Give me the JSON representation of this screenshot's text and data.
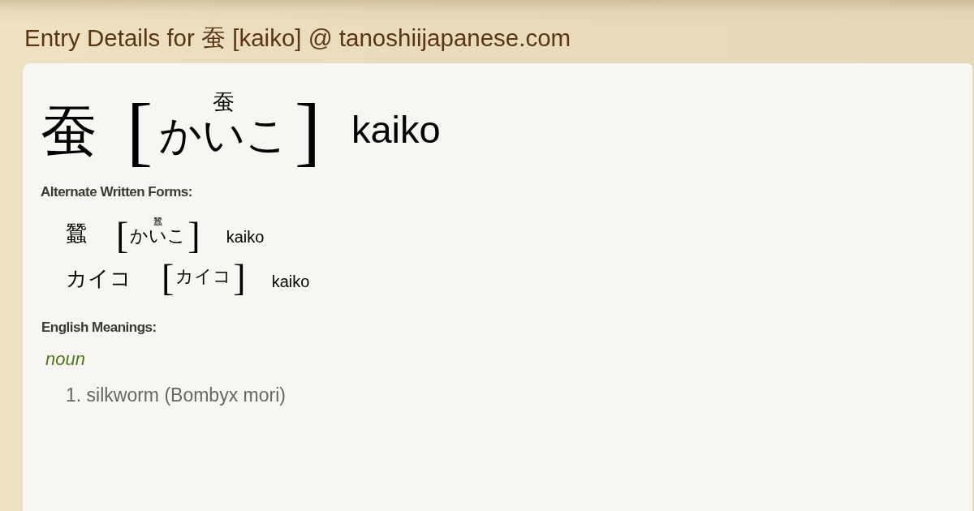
{
  "page_title": "Entry Details for 蚕 [kaiko] @ tanoshiijapanese.com",
  "entry": {
    "headword": "蚕",
    "open_bracket": "[",
    "furigana": "蚕",
    "reading": "かいこ",
    "close_bracket": "]",
    "romaji": "kaiko"
  },
  "alternate_forms": {
    "heading": "Alternate Written Forms:",
    "items": [
      {
        "written": "蠶",
        "open_bracket": "[",
        "furigana": "蠶",
        "reading": "かいこ",
        "close_bracket": "]",
        "romaji": "kaiko"
      },
      {
        "written": "カイコ",
        "open_bracket": "[",
        "reading": "カイコ",
        "close_bracket": "]",
        "romaji": "kaiko"
      }
    ]
  },
  "meanings": {
    "heading": "English Meanings:",
    "part_of_speech": "noun",
    "senses": [
      "1. silkworm (Bombyx mori)"
    ]
  }
}
